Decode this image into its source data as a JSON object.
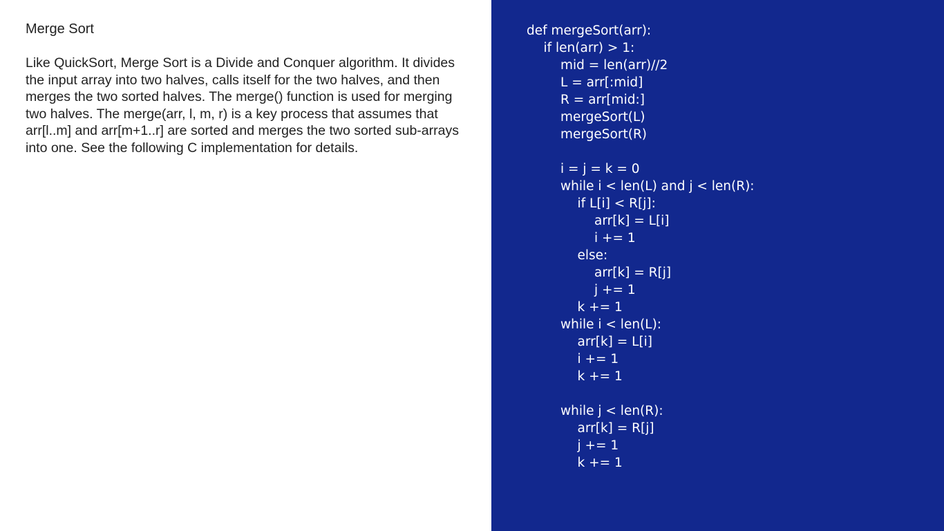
{
  "slide": {
    "title": "Merge Sort",
    "description": "Like QuickSort, Merge Sort is a Divide and Conquer algorithm. It divides the input array into two halves, calls itself for the two halves, and then merges the two sorted halves. The merge() function is used for merging two halves. The merge(arr, l, m, r) is a key process that assumes that arr[l..m] and arr[m+1..r] are sorted and merges the two sorted sub-arrays into one. See the following C implementation for details.",
    "colors": {
      "code_panel_background": "#12288e",
      "code_text": "#ffffff",
      "body_text": "#222222"
    }
  },
  "code": {
    "lines": [
      {
        "indent": 0,
        "text": "def mergeSort(arr):"
      },
      {
        "indent": 1,
        "text": "if len(arr) > 1:"
      },
      {
        "indent": 2,
        "text": "mid = len(arr)//2"
      },
      {
        "indent": 2,
        "text": "L = arr[:mid]"
      },
      {
        "indent": 2,
        "text": "R = arr[mid:]"
      },
      {
        "indent": 2,
        "text": "mergeSort(L)"
      },
      {
        "indent": 2,
        "text": "mergeSort(R)"
      },
      {
        "indent": 0,
        "text": ""
      },
      {
        "indent": 2,
        "text": "i = j = k = 0"
      },
      {
        "indent": 2,
        "text": "while i < len(L) and j < len(R):"
      },
      {
        "indent": 3,
        "text": "if L[i] < R[j]:"
      },
      {
        "indent": 4,
        "text": "arr[k] = L[i]"
      },
      {
        "indent": 4,
        "text": "i += 1"
      },
      {
        "indent": 3,
        "text": "else:"
      },
      {
        "indent": 4,
        "text": "arr[k] = R[j]"
      },
      {
        "indent": 4,
        "text": "j += 1"
      },
      {
        "indent": 3,
        "text": "k += 1"
      },
      {
        "indent": 2,
        "text": "while i < len(L):"
      },
      {
        "indent": 3,
        "text": "arr[k] = L[i]"
      },
      {
        "indent": 3,
        "text": "i += 1"
      },
      {
        "indent": 3,
        "text": "k += 1"
      },
      {
        "indent": 0,
        "text": ""
      },
      {
        "indent": 2,
        "text": "while j < len(R):"
      },
      {
        "indent": 3,
        "text": "arr[k] = R[j]"
      },
      {
        "indent": 3,
        "text": "j += 1"
      },
      {
        "indent": 3,
        "text": "k += 1"
      }
    ]
  }
}
